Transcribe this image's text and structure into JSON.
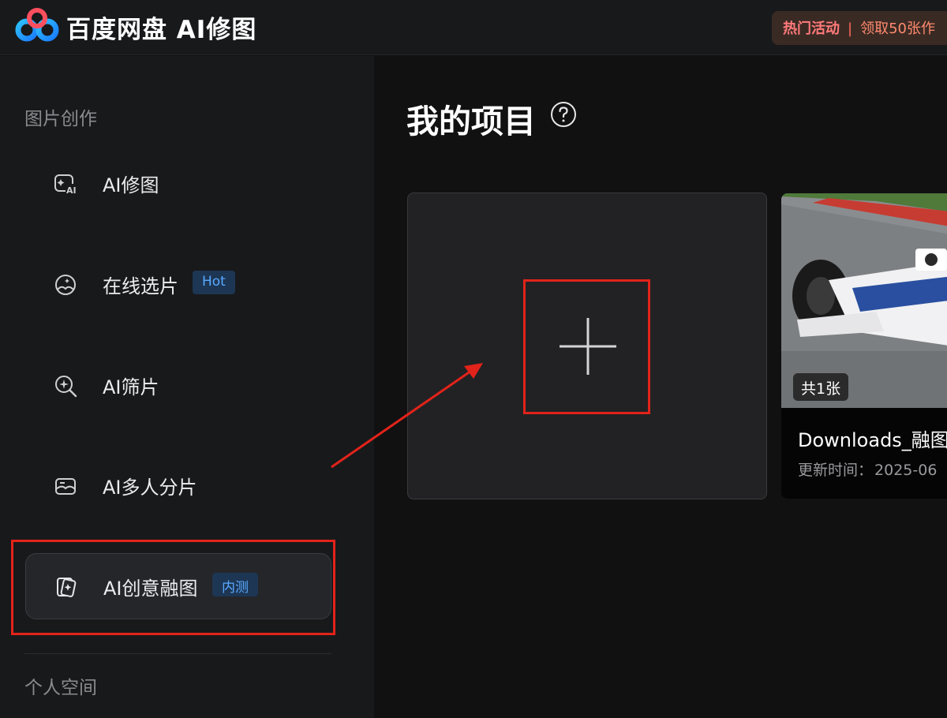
{
  "app": {
    "title": "百度网盘 AI修图",
    "promo": {
      "hot_label": "热门活动",
      "separator": "|",
      "text": "领取50张作"
    }
  },
  "sidebar": {
    "section_create": "图片创作",
    "items": [
      {
        "label": "AI修图",
        "icon": "ai-edit-icon"
      },
      {
        "label": "在线选片",
        "icon": "photo-select-icon",
        "badge": "Hot"
      },
      {
        "label": "AI筛片",
        "icon": "search-plus-icon"
      },
      {
        "label": "AI多人分片",
        "icon": "multi-person-icon"
      },
      {
        "label": "AI创意融图",
        "icon": "fusion-icon",
        "badge": "内测",
        "active": true
      }
    ],
    "section_personal": "个人空间"
  },
  "main": {
    "title": "我的项目",
    "help_icon": "help-circle-icon",
    "new_project_icon": "plus-icon",
    "projects": [
      {
        "count": "共1张",
        "name": "Downloads_融图",
        "time_label": "更新时间：",
        "time_value": "2025-06"
      }
    ]
  },
  "colors": {
    "background": "#111112",
    "sidebar": "#18191b",
    "accent_blue": "#59a8ff",
    "annotation_red": "#e2231a"
  }
}
